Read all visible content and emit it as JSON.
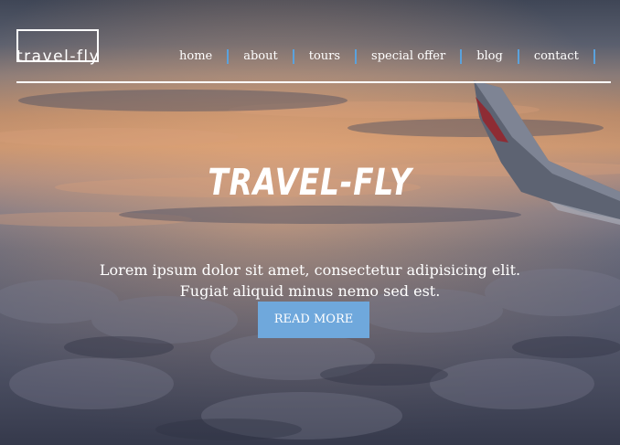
{
  "brand": {
    "logo_text": "travel-fly"
  },
  "nav": {
    "items": [
      {
        "label": "home"
      },
      {
        "label": "about"
      },
      {
        "label": "tours"
      },
      {
        "label": "special offer"
      },
      {
        "label": "blog"
      },
      {
        "label": "contact"
      }
    ]
  },
  "hero": {
    "title": "TRAVEL-FLY",
    "tagline_line1": "Lorem ipsum dolor sit amet, consectetur adipisicing elit.",
    "tagline_line2": "Fugiat aliquid minus nemo sed est.",
    "button_label": "READ MORE",
    "background_icon": "airplane-wing-over-clouds"
  },
  "colors": {
    "accent": "#6fa8dc",
    "nav_separator": "#5aa2dd",
    "text": "#ffffff"
  }
}
